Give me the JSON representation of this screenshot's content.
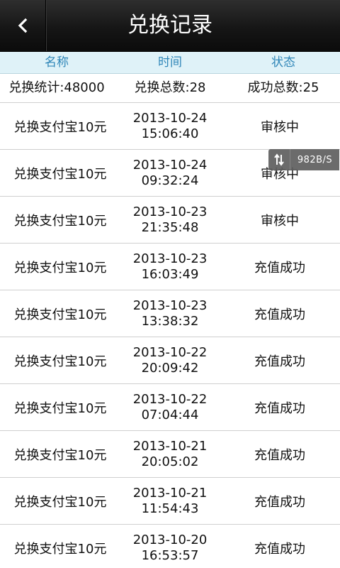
{
  "header": {
    "title": "兑换记录"
  },
  "columns": [
    "名称",
    "时间",
    "状态"
  ],
  "summary": {
    "total_points": "兑换统计:48000",
    "total_count": "兑换总数:28",
    "success_count": "成功总数:25"
  },
  "records": [
    {
      "name": "兑换支付宝10元",
      "date": "2013-10-24",
      "time": "15:06:40",
      "status": "审核中"
    },
    {
      "name": "兑换支付宝10元",
      "date": "2013-10-24",
      "time": "09:32:24",
      "status": "审核中"
    },
    {
      "name": "兑换支付宝10元",
      "date": "2013-10-23",
      "time": "21:35:48",
      "status": "审核中"
    },
    {
      "name": "兑换支付宝10元",
      "date": "2013-10-23",
      "time": "16:03:49",
      "status": "充值成功"
    },
    {
      "name": "兑换支付宝10元",
      "date": "2013-10-23",
      "time": "13:38:32",
      "status": "充值成功"
    },
    {
      "name": "兑换支付宝10元",
      "date": "2013-10-22",
      "time": "20:09:42",
      "status": "充值成功"
    },
    {
      "name": "兑换支付宝10元",
      "date": "2013-10-22",
      "time": "07:04:44",
      "status": "充值成功"
    },
    {
      "name": "兑换支付宝10元",
      "date": "2013-10-21",
      "time": "20:05:02",
      "status": "充值成功"
    },
    {
      "name": "兑换支付宝10元",
      "date": "2013-10-21",
      "time": "11:54:43",
      "status": "充值成功"
    },
    {
      "name": "兑换支付宝10元",
      "date": "2013-10-20",
      "time": "16:53:57",
      "status": "充值成功"
    }
  ],
  "overlay": {
    "net_speed": "982B/S",
    "icon": "up-down-arrows-icon"
  },
  "colors": {
    "titlebar": "#161616",
    "column_header_bg": "#dff2f8",
    "column_header_text": "#2f86b8"
  }
}
